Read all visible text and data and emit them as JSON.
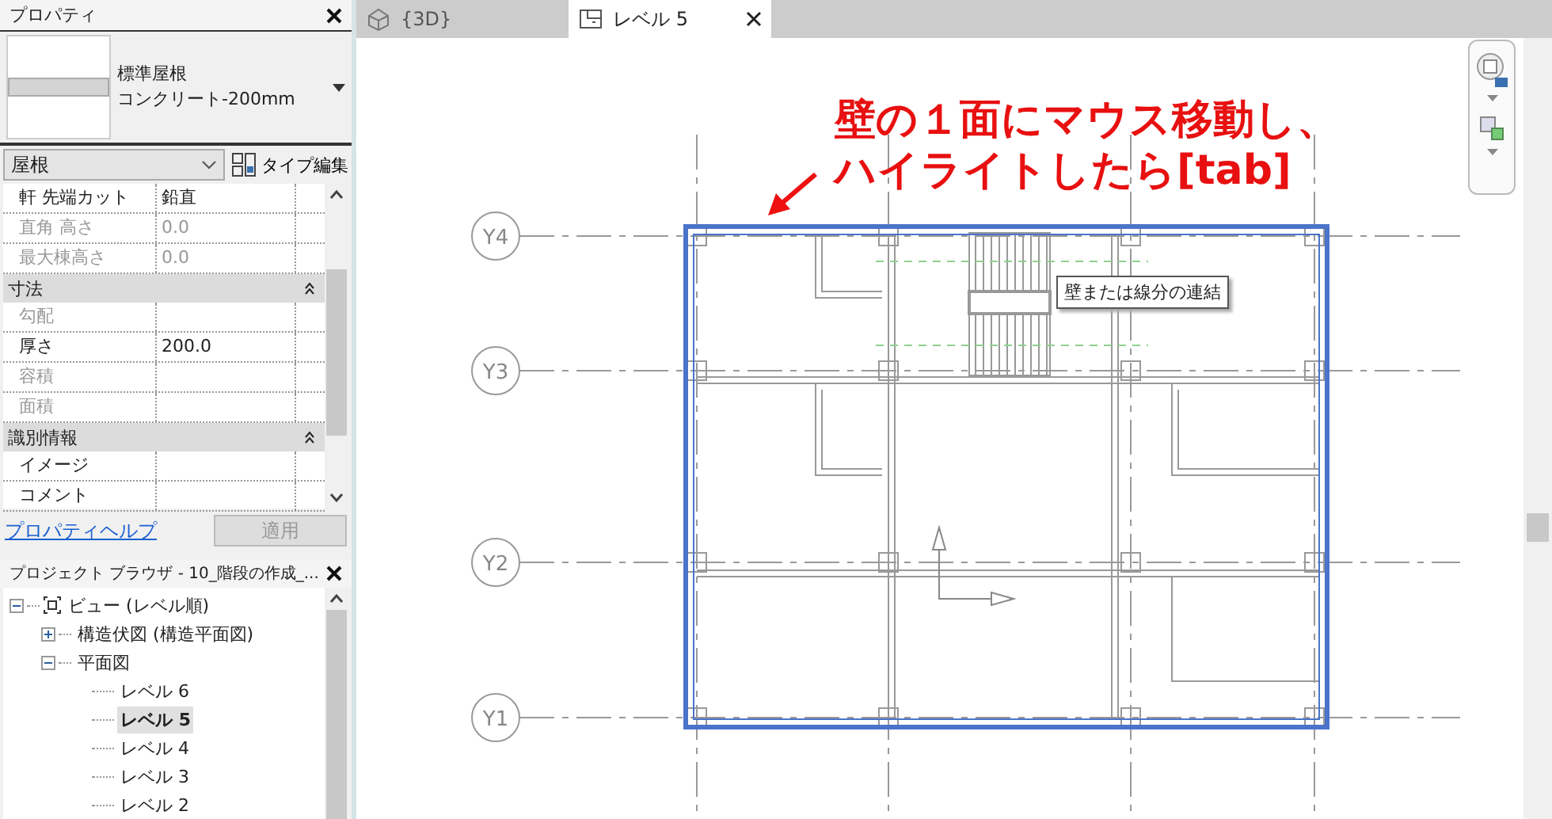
{
  "properties": {
    "title": "プロパティ",
    "type_name": "標準屋根",
    "type_detail": "コンクリート-200mm",
    "category": "屋根",
    "edit_type": "タイプ編集",
    "rows": [
      {
        "kind": "param",
        "label": "軒 先端カット",
        "value": "鉛直",
        "disabled": false
      },
      {
        "kind": "param",
        "label": "直角 高さ",
        "value": "0.0",
        "disabled": true
      },
      {
        "kind": "param",
        "label": "最大棟高さ",
        "value": "0.0",
        "disabled": true
      },
      {
        "kind": "header",
        "label": "寸法"
      },
      {
        "kind": "param",
        "label": "勾配",
        "value": "",
        "disabled": true
      },
      {
        "kind": "param",
        "label": "厚さ",
        "value": "200.0",
        "disabled": false
      },
      {
        "kind": "param",
        "label": "容積",
        "value": "",
        "disabled": true
      },
      {
        "kind": "param",
        "label": "面積",
        "value": "",
        "disabled": true
      },
      {
        "kind": "header",
        "label": "識別情報"
      },
      {
        "kind": "param",
        "label": "イメージ",
        "value": "",
        "disabled": false
      },
      {
        "kind": "param",
        "label": "コメント",
        "value": "",
        "disabled": false
      }
    ],
    "help_link": "プロパティヘルプ",
    "apply": "適用"
  },
  "browser": {
    "title": "プロジェクト ブラウザ - 10_階段の作成_...",
    "tree": [
      {
        "label": "ビュー (レベル順)",
        "expanded": true,
        "selected": false,
        "children": [
          {
            "label": "構造伏図 (構造平面図)",
            "expanded": false,
            "selected": false
          },
          {
            "label": "平面図",
            "expanded": true,
            "selected": false,
            "children": [
              {
                "label": "レベル 6",
                "selected": false
              },
              {
                "label": "レベル 5",
                "selected": true
              },
              {
                "label": "レベル 4",
                "selected": false
              },
              {
                "label": "レベル 3",
                "selected": false
              },
              {
                "label": "レベル 2",
                "selected": false
              }
            ]
          }
        ]
      }
    ]
  },
  "tabs": [
    {
      "label": "{3D}",
      "kind": "model",
      "selected": false
    },
    {
      "label": "レベル 5",
      "kind": "plan",
      "selected": true
    }
  ],
  "canvas": {
    "grid_labels": [
      "Y4",
      "Y3",
      "Y2",
      "Y1"
    ],
    "tooltip": "壁または線分の連結",
    "annotation": [
      "壁の１面にマウス移動し、",
      "ハイライトしたら[tab]"
    ]
  }
}
